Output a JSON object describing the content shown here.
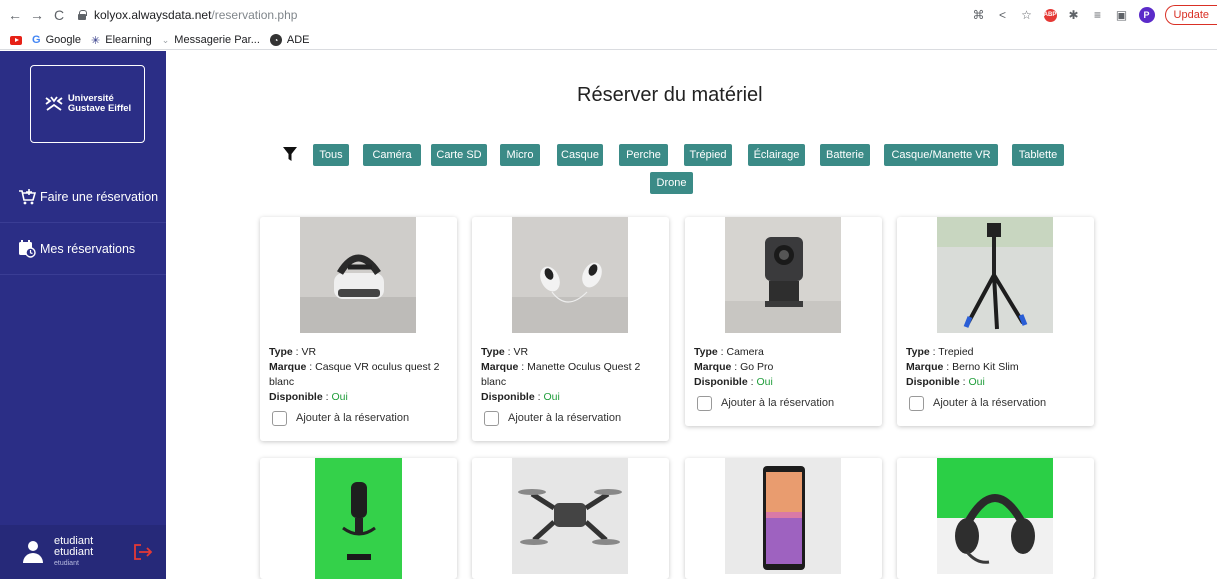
{
  "browser": {
    "url_host": "kolyox.alwaysdata.net",
    "url_path": "/reservation.php",
    "update_label": "Update",
    "profile_initial": "P",
    "bookmarks": [
      {
        "label": "Google",
        "icon": "google-icon"
      },
      {
        "label": "Elearning",
        "icon": "elearning-icon"
      },
      {
        "label": "Messagerie Par...",
        "icon": "mail-icon"
      },
      {
        "label": "ADE",
        "icon": "ade-icon"
      }
    ]
  },
  "sidebar": {
    "logo_line1": "Université",
    "logo_line2": "Gustave Eiffel",
    "items": [
      {
        "label": "Faire une réservation",
        "icon": "cart-plus-icon"
      },
      {
        "label": "Mes réservations",
        "icon": "calendar-clock-icon"
      }
    ],
    "user": {
      "first": "etudiant",
      "last": "etudiant",
      "role": "etudiant"
    }
  },
  "main": {
    "title": "Réserver du matériel",
    "filters": [
      "Tous",
      "Caméra",
      "Carte SD",
      "Micro",
      "Casque",
      "Perche",
      "Trépied",
      "Éclairage",
      "Batterie",
      "Casque/Manette VR",
      "Tablette",
      "Drone"
    ],
    "labels": {
      "type": "Type",
      "brand": "Marque",
      "available": "Disponible",
      "add": "Ajouter à la réservation"
    },
    "cards": [
      {
        "type": "VR",
        "brand": "Casque VR oculus quest 2 blanc",
        "available": "Oui",
        "image": "vr-headset"
      },
      {
        "type": "VR",
        "brand": "Manette Oculus Quest 2 blanc",
        "available": "Oui",
        "image": "vr-controllers"
      },
      {
        "type": "Camera",
        "brand": "Go Pro",
        "available": "Oui",
        "image": "action-camera"
      },
      {
        "type": "Trepied",
        "brand": "Berno Kit Slim",
        "available": "Oui",
        "image": "tripod"
      },
      {
        "image": "microphone"
      },
      {
        "image": "drone"
      },
      {
        "image": "tablet"
      },
      {
        "image": "headset"
      }
    ]
  },
  "colors": {
    "sidebar": "#2b2e86",
    "chip": "#3b8b87",
    "available": "#1f9d3a",
    "logout": "#e53935"
  }
}
